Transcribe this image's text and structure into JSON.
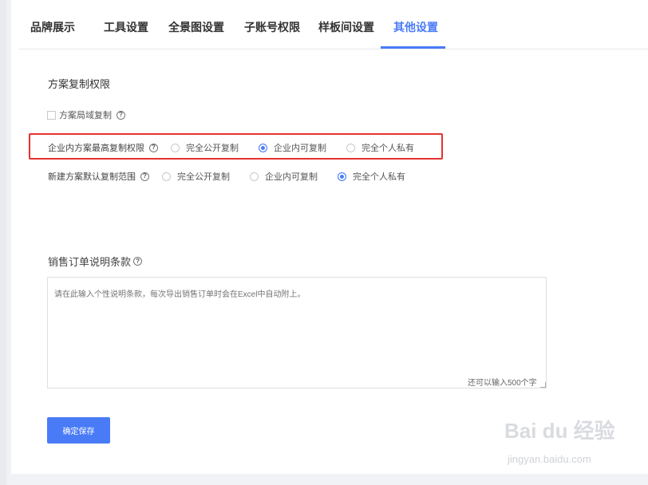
{
  "tabs": [
    {
      "label": "品牌展示",
      "active": false
    },
    {
      "label": "工具设置",
      "active": false
    },
    {
      "label": "全景图设置",
      "active": false
    },
    {
      "label": "子账号权限",
      "active": false
    },
    {
      "label": "样板间设置",
      "active": false
    },
    {
      "label": "其他设置",
      "active": true
    }
  ],
  "copy_permission": {
    "section_title": "方案复制权限",
    "checkbox_label": "方案局域复制",
    "checkbox_checked": false,
    "max_permission": {
      "label": "企业内方案最高复制权限",
      "options": [
        "完全公开复制",
        "企业内可复制",
        "完全个人私有"
      ],
      "selected": "企业内可复制"
    },
    "default_scope": {
      "label": "新建方案默认复制范围",
      "options": [
        "完全公开复制",
        "企业内可复制",
        "完全个人私有"
      ],
      "selected": "完全个人私有"
    }
  },
  "sales_order": {
    "label": "销售订单说明条款",
    "placeholder": "请在此输入个性说明条款，每次导出销售订单时会在Excel中自动附上。",
    "counter": "还可以输入500个字"
  },
  "save_button": "确定保存",
  "watermark": {
    "brand": "Bai du 经验",
    "url": "jingyan.baidu.com"
  },
  "colors": {
    "accent": "#4a7bf7",
    "highlight": "#e5322d"
  }
}
